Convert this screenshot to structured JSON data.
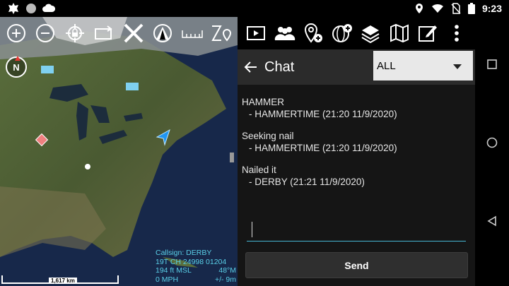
{
  "status": {
    "time": "9:23"
  },
  "map": {
    "compass_label": "N",
    "scale_label": "1,617 km",
    "info": {
      "callsign": "Callsign: DERBY",
      "grid": "19T  CH  24998  01204",
      "altitude": "194 ft MSL",
      "heading": "48°M",
      "speed": "0 MPH",
      "accuracy": "+/- 9m"
    }
  },
  "chat": {
    "title": "Chat",
    "filter": {
      "selected": "ALL"
    },
    "messages": [
      {
        "text": "HAMMER",
        "meta": "- HAMMERTIME (21:20 11/9/2020)"
      },
      {
        "text": "Seeking nail",
        "meta": "- HAMMERTIME (21:20 11/9/2020)"
      },
      {
        "text": "Nailed it",
        "meta": "- DERBY (21:21 11/9/2020)"
      }
    ],
    "input": {
      "value": "",
      "placeholder": ""
    },
    "send_label": "Send"
  },
  "colors": {
    "accent": "#46b6d4",
    "info_text": "#5ad0e8",
    "hostile_marker": "#f08080",
    "self_marker": "#2196f3"
  }
}
